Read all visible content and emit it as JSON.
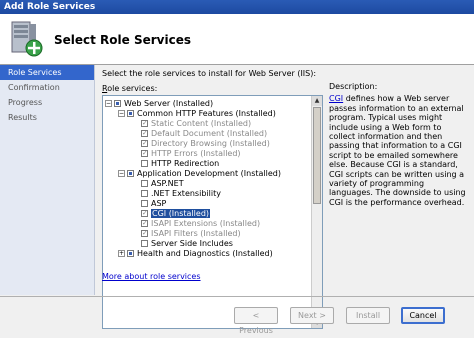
{
  "window": {
    "title": "Add Role Services"
  },
  "header": {
    "title": "Select Role Services"
  },
  "nav": [
    "Role Services",
    "Confirmation",
    "Progress",
    "Results"
  ],
  "content": {
    "instruction": "Select the role services to install for Web Server (IIS):",
    "roles_label_prefix": "R",
    "roles_label_rest": "ole services:",
    "tree": [
      {
        "label": "Web Server  (Installed)"
      },
      {
        "label": "Common HTTP Features  (Installed)"
      },
      {
        "label": "Static Content  (Installed)"
      },
      {
        "label": "Default Document  (Installed)"
      },
      {
        "label": "Directory Browsing  (Installed)"
      },
      {
        "label": "HTTP Errors  (Installed)"
      },
      {
        "label": "HTTP Redirection"
      },
      {
        "label": "Application Development  (Installed)"
      },
      {
        "label": "ASP.NET"
      },
      {
        "label": ".NET Extensibility"
      },
      {
        "label": "ASP"
      },
      {
        "label": "CGI  (Installed)"
      },
      {
        "label": "ISAPI Extensions  (Installed)"
      },
      {
        "label": "ISAPI Filters  (Installed)"
      },
      {
        "label": "Server Side Includes"
      },
      {
        "label": "Health and Diagnostics  (Installed)"
      }
    ],
    "description_label": "Description:",
    "description_link": "CGI",
    "description_text": " defines how a Web server passes information to an external program. Typical uses might include using a Web form to collect information and then passing that information to a CGI script to be emailed somewhere else. Because CGI is a standard, CGI scripts can be written using a variety of programming languages. The downside to using CGI is the performance overhead.",
    "more_link": "More about role services"
  },
  "buttons": {
    "previous": "< Previous",
    "next": "Next >",
    "install": "Install",
    "cancel": "Cancel"
  }
}
